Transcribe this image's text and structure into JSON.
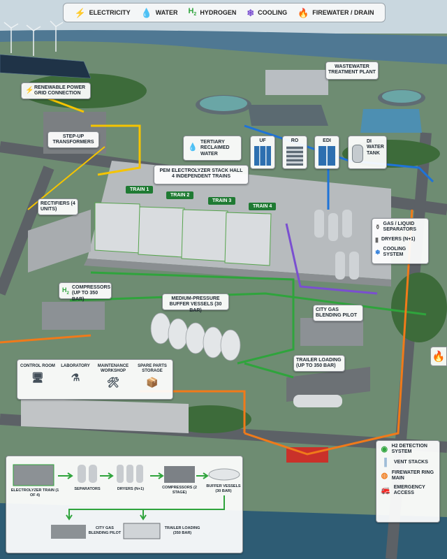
{
  "legend": [
    {
      "icon": "⚡",
      "icon_name": "lightning-icon",
      "label": "ELECTRICITY",
      "color": "#f5c400"
    },
    {
      "icon": "💧",
      "icon_name": "water-drop-icon",
      "label": "WATER",
      "color": "#1e73d8"
    },
    {
      "icon": "H2",
      "icon_name": "hydrogen-icon",
      "label": "HYDROGEN",
      "color": "#2fa43c"
    },
    {
      "icon": "❄",
      "icon_name": "snowflake-icon",
      "label": "COOLING",
      "color": "#7a4fd0"
    },
    {
      "icon": "🔥",
      "icon_name": "flame-icon",
      "label": "FIREWATER / DRAIN",
      "color": "#f07a1a"
    }
  ],
  "labels": {
    "wastewater": "WASTEWATER TREATMENT PLANT",
    "renewable": "RENEWABLE POWER GRID CONNECTION",
    "stepup": "STEP-UP TRANSFORMERS",
    "tertiary": "TERTIARY RECLAIMED WATER",
    "uf": "UF",
    "ro": "RO",
    "edi": "EDI",
    "di_tank": "DI WATER TANK",
    "stack_hall_1": "PEM ELECTROLYZER STACK HALL",
    "stack_hall_2": "4 INDEPENDENT TRAINS",
    "rectifiers": "RECTIFIERS (4 UNITS)",
    "train1": "TRAIN 1",
    "train2": "TRAIN 2",
    "train3": "TRAIN 3",
    "train4": "TRAIN 4",
    "gas_liquid": "GAS / LIQUID SEPARATORS",
    "dryers": "DRYERS (N+1)",
    "cooling_system": "COOLING SYSTEM",
    "compressors": "COMPRESSORS (UP TO 350 BAR)",
    "buffer": "MEDIUM-PRESSURE BUFFER VESSELS (30 BAR)",
    "city_gas": "CITY GAS BLENDING PILOT",
    "trailer": "TRAILER LOADING (UP TO 350 BAR)"
  },
  "buildings": [
    {
      "label": "CONTROL ROOM",
      "icon_name": "monitor-icon"
    },
    {
      "label": "LABORATORY",
      "icon_name": "flask-icon"
    },
    {
      "label": "MAINTENANCE WORKSHOP",
      "icon_name": "tools-icon"
    },
    {
      "label": "SPARE PARTS STORAGE",
      "icon_name": "box-icon"
    }
  ],
  "safety": [
    {
      "label": "H2 DETECTION SYSTEM",
      "icon_name": "detector-icon"
    },
    {
      "label": "VENT STACKS",
      "icon_name": "vent-stack-icon"
    },
    {
      "label": "FIREWATER RING MAIN",
      "icon_name": "firewater-icon"
    },
    {
      "label": "EMERGENCY ACCESS",
      "icon_name": "fire-truck-icon"
    }
  ],
  "process_flow": [
    "ELECTROLYZER TRAIN (1 OF 4)",
    "SEPARATORS",
    "DRYERS (N+1)",
    "COMPRESSORS (2 STAGE)",
    "BUFFER VESSELS (30 BAR)",
    "CITY GAS BLENDING PILOT",
    "TRAILER LOADING (350 BAR)"
  ]
}
